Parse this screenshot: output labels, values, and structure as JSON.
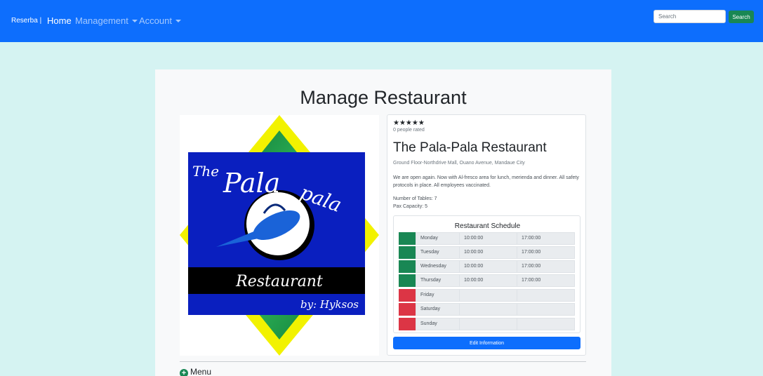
{
  "navbar": {
    "brand": "Reserba |",
    "links": [
      {
        "label": "Home"
      },
      {
        "label": "Management"
      },
      {
        "label": "Account"
      }
    ],
    "search_placeholder": "Search",
    "search_button": "Search"
  },
  "page": {
    "title": "Manage Restaurant"
  },
  "logo": {
    "line1": "The",
    "line2": "Pala",
    "line3": "pala",
    "banner": "Restaurant",
    "byline": "by: Hyksos"
  },
  "restaurant": {
    "stars": "★★★★★",
    "rated": "0 people rated",
    "name": "The Pala-Pala Restaurant",
    "address": "Ground Floor-Northdrive Mall, Ouano Avenue, Mandaue City",
    "description": "We are open again. Now with Al-fresco area for lunch, merienda and dinner. All safety protocols in place. All employees vaccinated.",
    "tables": "Number of Tables: 7",
    "capacity": "Pax Capacity: 5"
  },
  "schedule": {
    "title": "Restaurant Schedule",
    "open_color": "#198754",
    "closed_color": "#dc3545",
    "rows": [
      {
        "day": "Monday",
        "open": "10:00:00",
        "close": "17:00:00",
        "status": "open"
      },
      {
        "day": "Tuesday",
        "open": "10:00:00",
        "close": "17:00:00",
        "status": "open"
      },
      {
        "day": "Wednesday",
        "open": "10:00:00",
        "close": "17:00:00",
        "status": "open"
      },
      {
        "day": "Thursday",
        "open": "10:00:00",
        "close": "17:00:00",
        "status": "open"
      },
      {
        "day": "Friday",
        "open": "",
        "close": "",
        "status": "closed"
      },
      {
        "day": "Saturday",
        "open": "",
        "close": "",
        "status": "closed"
      },
      {
        "day": "Sunday",
        "open": "",
        "close": "",
        "status": "closed"
      }
    ]
  },
  "actions": {
    "edit": "Edit Information"
  },
  "menu_section": {
    "icon": "plus-circle-icon",
    "label": "Menu"
  }
}
